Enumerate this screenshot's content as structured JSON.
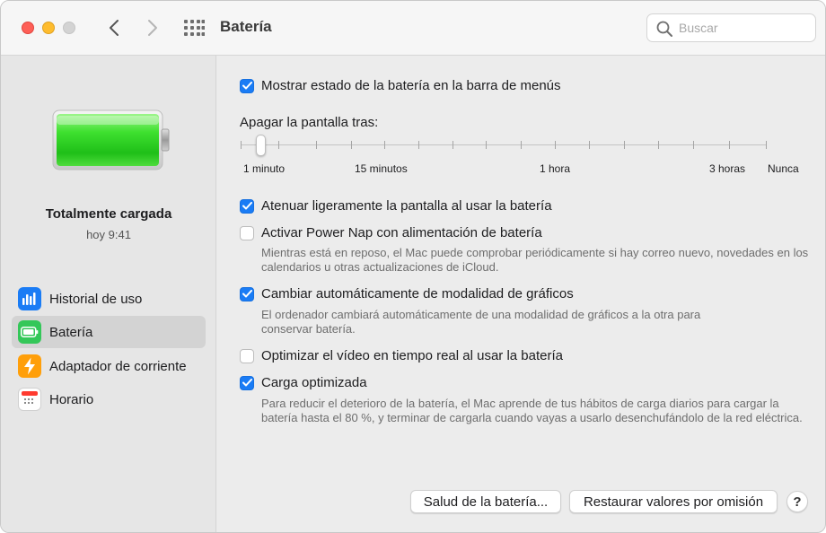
{
  "window": {
    "title": "Batería"
  },
  "search": {
    "placeholder": "Buscar"
  },
  "status": {
    "title": "Totalmente cargada",
    "time": "hoy 9:41",
    "charge_level": 1.0,
    "battery_color": "#2ecf27"
  },
  "sidebar": {
    "items": [
      {
        "label": "Historial de uso",
        "icon": "bar-chart-icon",
        "color": "#1a7cf5",
        "selected": false
      },
      {
        "label": "Batería",
        "icon": "battery-icon",
        "color": "#34c759",
        "selected": true
      },
      {
        "label": "Adaptador de corriente",
        "icon": "lightning-icon",
        "color": "#ff9f0a",
        "selected": false
      },
      {
        "label": "Horario",
        "icon": "calendar-icon",
        "color": "#ff3b30",
        "selected": false
      }
    ]
  },
  "options": {
    "show_status": {
      "label": "Mostrar estado de la batería en la barra de menús",
      "checked": true
    },
    "dim_display": {
      "label": "Atenuar ligeramente la pantalla al usar la batería",
      "checked": true
    },
    "power_nap": {
      "label": "Activar Power Nap con alimentación de batería",
      "checked": false,
      "description": "Mientras está en reposo, el Mac puede comprobar periódicamente si hay correo nuevo, novedades en los calendarios u otras actualizaciones de iCloud."
    },
    "graphics": {
      "label": "Cambiar automáticamente de modalidad de gráficos",
      "checked": true,
      "description": "El ordenador cambiará automáticamente de una modalidad de gráficos a la otra para conservar batería."
    },
    "video": {
      "label": "Optimizar el vídeo en tiempo real al usar la batería",
      "checked": false
    },
    "optimized_charging": {
      "label": "Carga optimizada",
      "checked": true,
      "description": "Para reducir el deterioro de la batería, el Mac aprende de tus hábitos de carga diarios para cargar la batería hasta el 80 %, y terminar de cargarla cuando vayas a usarlo desenchufándolo de la red eléctrica."
    }
  },
  "display_off": {
    "label": "Apagar la pantalla tras:",
    "tick_labels": [
      "1 minuto",
      "15 minutos",
      "1 hora",
      "3 horas",
      "Nunca"
    ],
    "value": "1 minuto"
  },
  "buttons": {
    "battery_health": "Salud de la batería...",
    "restore_defaults": "Restaurar valores por omisión",
    "help": "?"
  },
  "colors": {
    "accent": "#1a7cf5",
    "close": "#fe5f57",
    "minimize": "#febc2e"
  }
}
